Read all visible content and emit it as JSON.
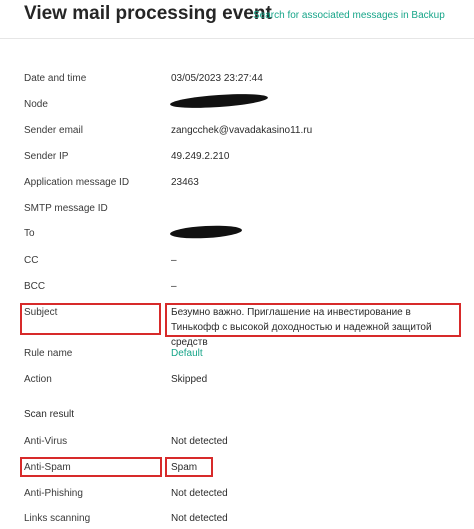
{
  "header": {
    "title": "View mail processing event",
    "backup_link": "Search for associated messages in Backup"
  },
  "fields": [
    {
      "label": "Date and time",
      "value": "03/05/2023 23:27:44"
    },
    {
      "label": "Node",
      "value": ""
    },
    {
      "label": "Sender email",
      "value": "zangcchek@vavadakasino11.ru"
    },
    {
      "label": "Sender IP",
      "value": "49.249.2.210"
    },
    {
      "label": "Application message ID",
      "value": "23463"
    },
    {
      "label": "SMTP message ID",
      "value": ""
    },
    {
      "label": "To",
      "value": ""
    },
    {
      "label": "CC",
      "value": "–"
    },
    {
      "label": "BCC",
      "value": "–"
    },
    {
      "label": "Subject",
      "value": "Безумно важно. Приглашение на инвестирование в Тинькофф с высокой доходностью и надежной защитой средств"
    },
    {
      "label": "Rule name",
      "value": "Default"
    },
    {
      "label": "Action",
      "value": "Skipped"
    }
  ],
  "scan_result": {
    "title": "Scan result",
    "items": [
      {
        "label": "Anti-Virus",
        "value": "Not detected"
      },
      {
        "label": "Anti-Spam",
        "value": "Spam"
      },
      {
        "label": "Anti-Phishing",
        "value": "Not detected"
      },
      {
        "label": "Links scanning",
        "value": "Not detected"
      }
    ]
  },
  "colors": {
    "accent": "#17a589",
    "highlight": "#d72a2a"
  }
}
